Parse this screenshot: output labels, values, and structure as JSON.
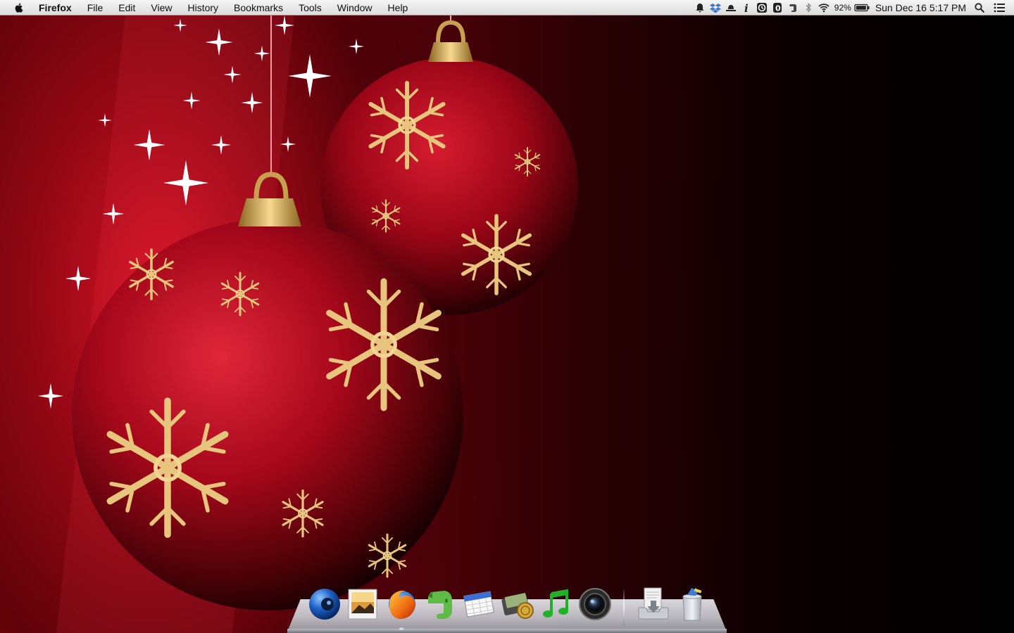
{
  "menubar": {
    "app_name": "Firefox",
    "menus": [
      "File",
      "Edit",
      "View",
      "History",
      "Bookmarks",
      "Tools",
      "Window",
      "Help"
    ],
    "battery_percent": "92%",
    "clock": "Sun Dec 16  5:17 PM",
    "status_icons": [
      "notification-bell-icon",
      "dropbox-icon",
      "hat-icon",
      "info-icon",
      "time-machine-icon",
      "one-password-icon",
      "evernote-icon",
      "bluetooth-icon",
      "wifi-icon",
      "battery-icon",
      "spotlight-icon",
      "notification-center-icon"
    ]
  },
  "dock": {
    "apps": [
      {
        "name": "finder-camera-icon",
        "running": false
      },
      {
        "name": "preview-icon",
        "running": false
      },
      {
        "name": "firefox-icon",
        "running": true
      },
      {
        "name": "evernote-icon",
        "running": false
      },
      {
        "name": "ical-icon",
        "running": false
      },
      {
        "name": "wallet-icon",
        "running": false
      },
      {
        "name": "itunes-icon",
        "running": false
      },
      {
        "name": "camera-icon",
        "running": false
      }
    ],
    "stacks": [
      {
        "name": "downloads-stack-icon"
      },
      {
        "name": "trash-icon"
      }
    ]
  },
  "colors": {
    "ornament_red": "#b3071c",
    "gold": "#e6c178",
    "menubar_bg": "#e8e8e8"
  }
}
